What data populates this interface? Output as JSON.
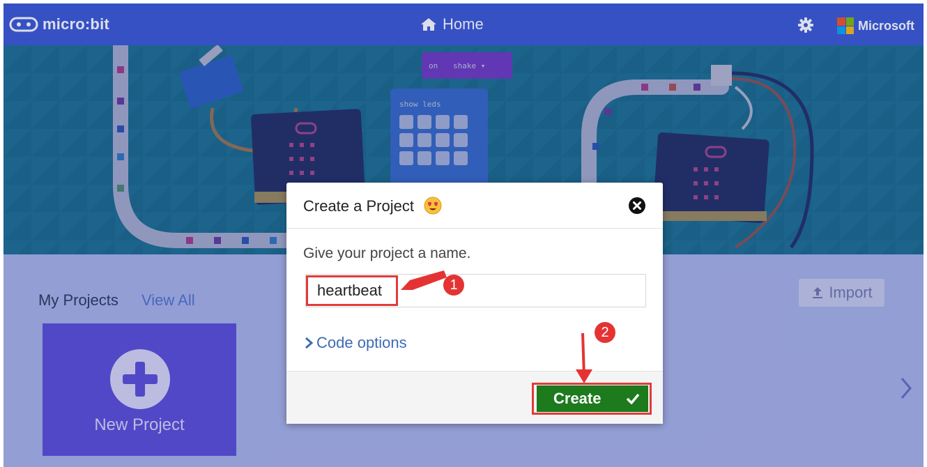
{
  "header": {
    "logo_text": "micro:bit",
    "home_label": "Home",
    "settings_icon": "gear-icon",
    "brand_label": "Microsoft",
    "colors": {
      "bar": "#3454d1",
      "ms_red": "#f25022",
      "ms_green": "#7fba00",
      "ms_blue": "#00a4ef",
      "ms_yellow": "#ffb900"
    }
  },
  "banner": {
    "block_on": "on",
    "block_event": "shake",
    "block_show": "show leds"
  },
  "projects": {
    "title": "My Projects",
    "view_all": "View All",
    "import_label": "Import",
    "new_project_label": "New Project"
  },
  "modal": {
    "title": "Create a Project",
    "prompt": "Give your project a name.",
    "name_value": "heartbeat",
    "code_options_label": "Code options",
    "create_label": "Create"
  },
  "annotations": {
    "step1": "1",
    "step2": "2",
    "highlight_color": "#e23b3b"
  }
}
